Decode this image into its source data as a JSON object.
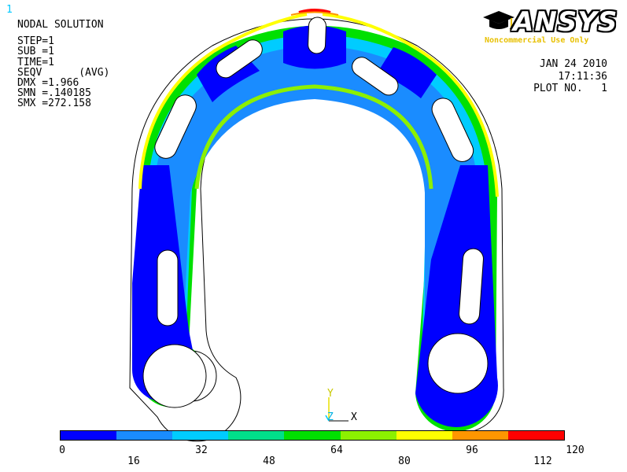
{
  "window_number": "1",
  "info": {
    "title": "NODAL SOLUTION",
    "step": "STEP=1",
    "sub": "SUB =1",
    "time": "TIME=1",
    "result": "SEQV      (AVG)",
    "dmx": "DMX =1.966",
    "smn": "SMN =.140185",
    "smx": "SMX =272.158"
  },
  "datestamp": {
    "date": "JAN 24 2010",
    "time": "17:11:36",
    "plot": "PLOT NO.   1"
  },
  "logo": {
    "word": "ANSYS",
    "tag": "Noncommercial Use Only",
    "accent_color": "#e8c000"
  },
  "triad": {
    "y_label": "Y",
    "z_label": "Z",
    "x_label": "X",
    "y_color": "#e8e000",
    "z_color": "#00c8ff"
  },
  "legend": {
    "colors": [
      "#0000ff",
      "#1a8cff",
      "#00ccff",
      "#00e08a",
      "#00e000",
      "#8cf000",
      "#ffff00",
      "#ff9600",
      "#ff0000"
    ],
    "ticks_top": [
      "0",
      "32",
      "64",
      "96",
      "120"
    ],
    "ticks_bottom": [
      "16",
      "48",
      "80",
      "112"
    ]
  }
}
